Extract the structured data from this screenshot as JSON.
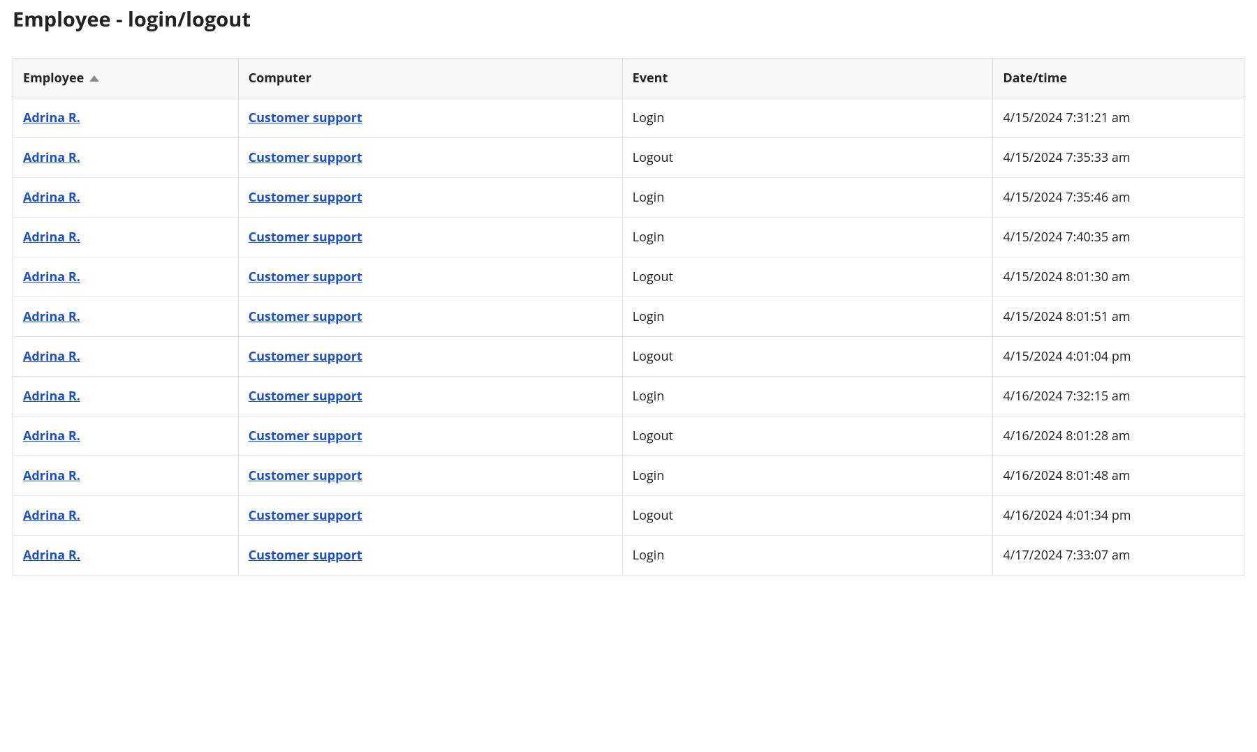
{
  "page": {
    "title": "Employee - login/logout"
  },
  "table": {
    "columns": {
      "employee": "Employee",
      "computer": "Computer",
      "event": "Event",
      "datetime": "Date/time"
    },
    "sort": {
      "column": "employee",
      "dir": "asc"
    },
    "rows": [
      {
        "employee": "Adrina R.",
        "computer": "Customer support",
        "event": "Login",
        "datetime": "4/15/2024 7:31:21 am"
      },
      {
        "employee": "Adrina R.",
        "computer": "Customer support",
        "event": "Logout",
        "datetime": "4/15/2024 7:35:33 am"
      },
      {
        "employee": "Adrina R.",
        "computer": "Customer support",
        "event": "Login",
        "datetime": "4/15/2024 7:35:46 am"
      },
      {
        "employee": "Adrina R.",
        "computer": "Customer support",
        "event": "Login",
        "datetime": "4/15/2024 7:40:35 am"
      },
      {
        "employee": "Adrina R.",
        "computer": "Customer support",
        "event": "Logout",
        "datetime": "4/15/2024 8:01:30 am"
      },
      {
        "employee": "Adrina R.",
        "computer": "Customer support",
        "event": "Login",
        "datetime": "4/15/2024 8:01:51 am"
      },
      {
        "employee": "Adrina R.",
        "computer": "Customer support",
        "event": "Logout",
        "datetime": "4/15/2024 4:01:04 pm"
      },
      {
        "employee": "Adrina R.",
        "computer": "Customer support",
        "event": "Login",
        "datetime": "4/16/2024 7:32:15 am"
      },
      {
        "employee": "Adrina R.",
        "computer": "Customer support",
        "event": "Logout",
        "datetime": "4/16/2024 8:01:28 am"
      },
      {
        "employee": "Adrina R.",
        "computer": "Customer support",
        "event": "Login",
        "datetime": "4/16/2024 8:01:48 am"
      },
      {
        "employee": "Adrina R.",
        "computer": "Customer support",
        "event": "Logout",
        "datetime": "4/16/2024 4:01:34 pm"
      },
      {
        "employee": "Adrina R.",
        "computer": "Customer support",
        "event": "Login",
        "datetime": "4/17/2024 7:33:07 am"
      }
    ]
  }
}
